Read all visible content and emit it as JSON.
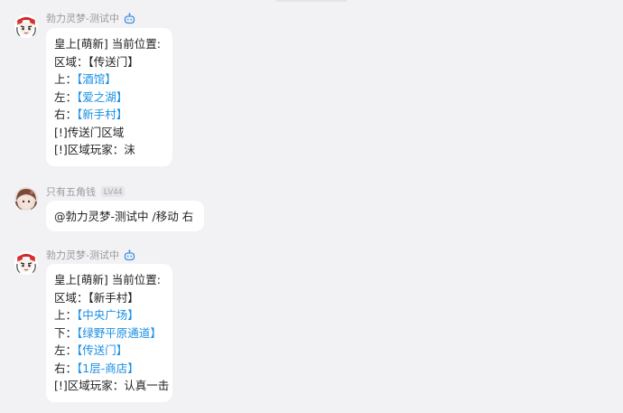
{
  "colors": {
    "background": "#f2f2f4",
    "bubble": "#ffffff",
    "link": "#1a8fe3",
    "name": "#9a9a9f"
  },
  "messages": [
    {
      "sender": "勃力灵梦-测试中",
      "is_bot": true,
      "avatar_icon": "bot-avatar-icon",
      "lines": [
        {
          "prefix": "皇上[萌新] 当前位置:",
          "link": ""
        },
        {
          "prefix": "区域：【传送门】",
          "link": ""
        },
        {
          "prefix": "上：",
          "link": "【酒馆】"
        },
        {
          "prefix": "左：",
          "link": "【爱之湖】"
        },
        {
          "prefix": "右：",
          "link": "【新手村】"
        },
        {
          "prefix": "[!]传送门区域",
          "link": ""
        },
        {
          "prefix": "[!]区域玩家：沫",
          "link": ""
        }
      ]
    },
    {
      "sender": "只有五角钱",
      "level": "LV44",
      "is_bot": false,
      "avatar_icon": "user-avatar-icon",
      "lines": [
        {
          "prefix": "@勃力灵梦-测试中 /移动 右",
          "link": ""
        }
      ]
    },
    {
      "sender": "勃力灵梦-测试中",
      "is_bot": true,
      "avatar_icon": "bot-avatar-icon",
      "lines": [
        {
          "prefix": "皇上[萌新] 当前位置:",
          "link": ""
        },
        {
          "prefix": "区域：【新手村】",
          "link": ""
        },
        {
          "prefix": "上：",
          "link": "【中央广场】"
        },
        {
          "prefix": "下：",
          "link": "【绿野平原通道】"
        },
        {
          "prefix": "左：",
          "link": "【传送门】"
        },
        {
          "prefix": "右：",
          "link": "【1层-商店】"
        },
        {
          "prefix": "[!]区域玩家：认真一击",
          "link": ""
        }
      ]
    }
  ]
}
